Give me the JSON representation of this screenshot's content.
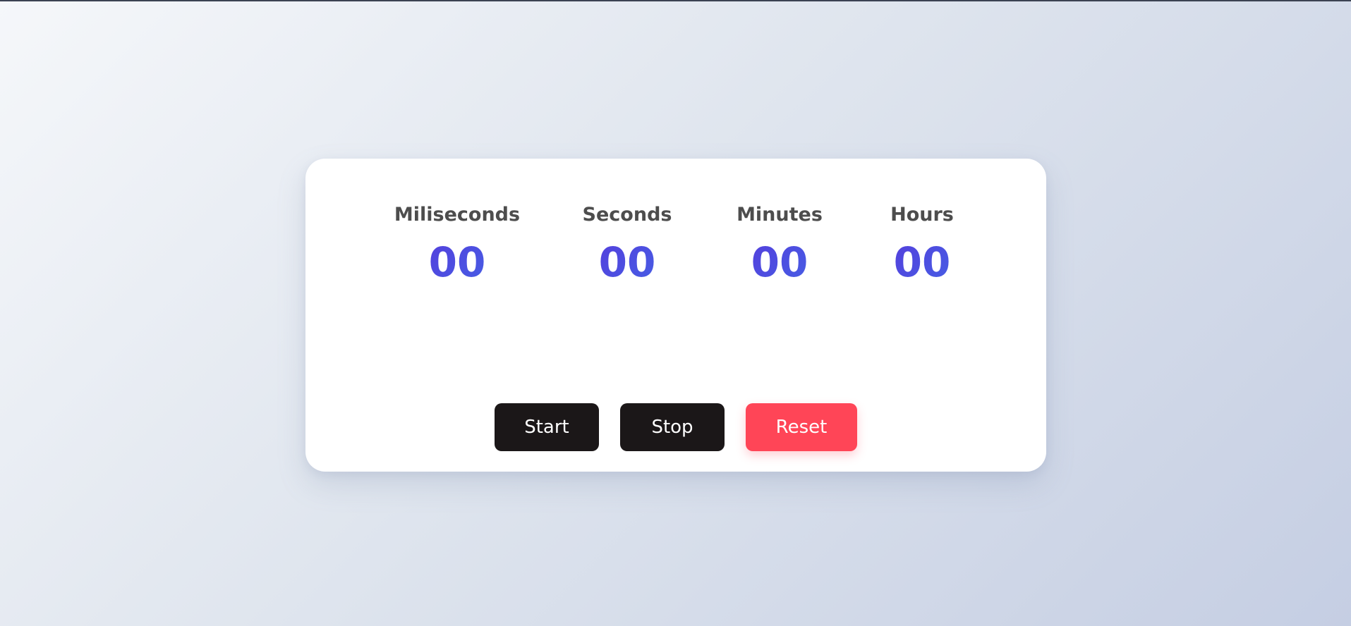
{
  "stopwatch": {
    "units": [
      {
        "label": "Miliseconds",
        "value": "00"
      },
      {
        "label": "Seconds",
        "value": "00"
      },
      {
        "label": "Minutes",
        "value": "00"
      },
      {
        "label": "Hours",
        "value": "00"
      }
    ],
    "buttons": {
      "start_label": "Start",
      "stop_label": "Stop",
      "reset_label": "Reset"
    }
  },
  "colors": {
    "value_gradient_start": "#5b2fd9",
    "value_gradient_end": "#3f6ee8",
    "label_text": "#4d4d4d",
    "dark_button": "#1b1718",
    "reset_button": "#ff4557",
    "card_background": "#ffffff"
  }
}
